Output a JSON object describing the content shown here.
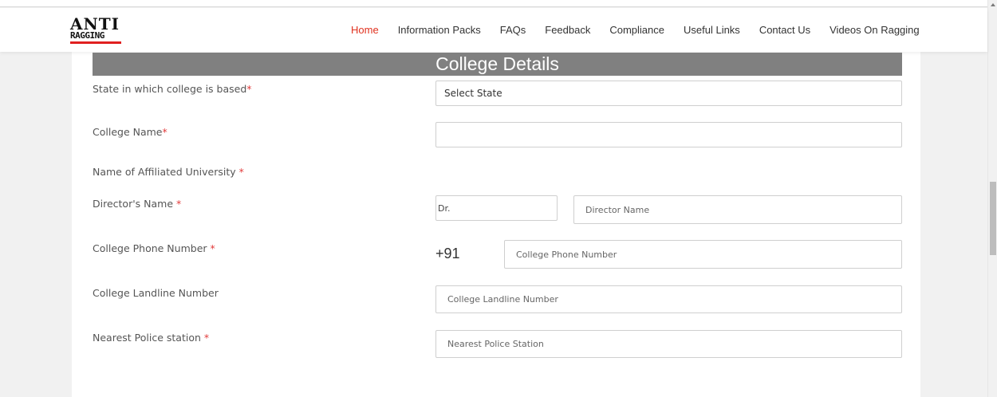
{
  "brand": {
    "logo_top": "ANTI",
    "logo_bottom": "RAGGING"
  },
  "nav": {
    "items": [
      {
        "label": "Home",
        "active": true
      },
      {
        "label": "Information Packs"
      },
      {
        "label": "FAQs"
      },
      {
        "label": "Feedback"
      },
      {
        "label": "Compliance"
      },
      {
        "label": "Useful Links"
      },
      {
        "label": "Contact Us"
      },
      {
        "label": "Videos On Ragging"
      }
    ]
  },
  "form": {
    "title": "College Details",
    "state": {
      "label": "State in which college is based",
      "required": "*",
      "value": "Select State"
    },
    "college_name": {
      "label": "College Name",
      "required": "*",
      "value": ""
    },
    "university": {
      "label": "Name of Affiliated University ",
      "required": "*"
    },
    "director": {
      "label": "Director's Name ",
      "required": "*",
      "title_value": "Dr.",
      "name_placeholder": "Director Name"
    },
    "phone": {
      "label": "College Phone Number ",
      "required": "*",
      "prefix": "+91",
      "placeholder": "College Phone Number"
    },
    "landline": {
      "label": "College Landline Number",
      "placeholder": "College Landline Number"
    },
    "police": {
      "label": "Nearest Police station ",
      "required": "*",
      "placeholder": "Nearest Police Station"
    }
  },
  "colors": {
    "accent": "#e0311e",
    "title_bar": "#808080",
    "required": "#e23b3b"
  }
}
